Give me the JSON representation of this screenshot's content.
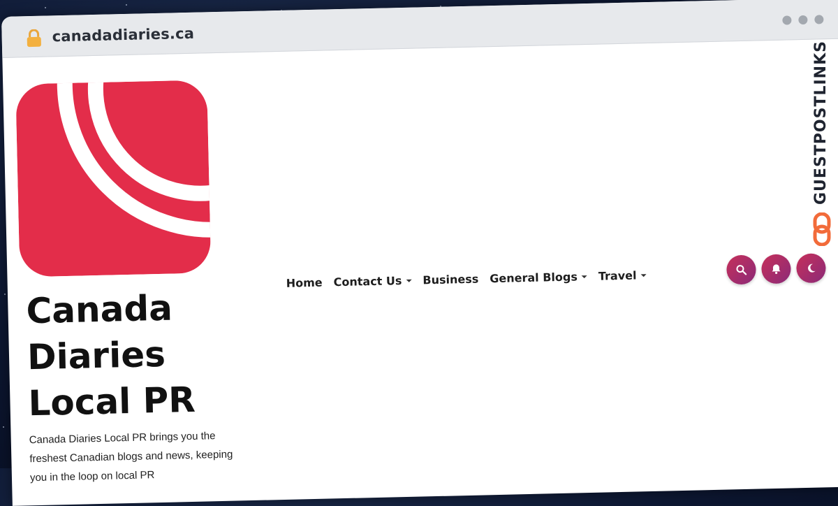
{
  "browser": {
    "url": "canadadiaries.ca",
    "lock_icon": "lock-icon"
  },
  "site": {
    "title": "Canada Diaries Local PR",
    "tagline": "Canada Diaries Local PR brings you the freshest Canadian blogs and news, keeping you in the loop on local PR",
    "logo_color": "#e32d4a"
  },
  "nav": {
    "items": [
      {
        "label": "Home",
        "has_dropdown": false
      },
      {
        "label": "Contact Us",
        "has_dropdown": true
      },
      {
        "label": "Business",
        "has_dropdown": false
      },
      {
        "label": "General Blogs",
        "has_dropdown": true
      },
      {
        "label": "Travel",
        "has_dropdown": true
      }
    ]
  },
  "actions": {
    "search_icon": "search-icon",
    "notification_icon": "bell-icon",
    "theme_icon": "moon-icon",
    "gradient_start": "#c6305a",
    "gradient_end": "#8b2a78"
  },
  "watermark": {
    "text": "GUESTPOSTLINKS",
    "icon_color": "#f26b3a"
  }
}
